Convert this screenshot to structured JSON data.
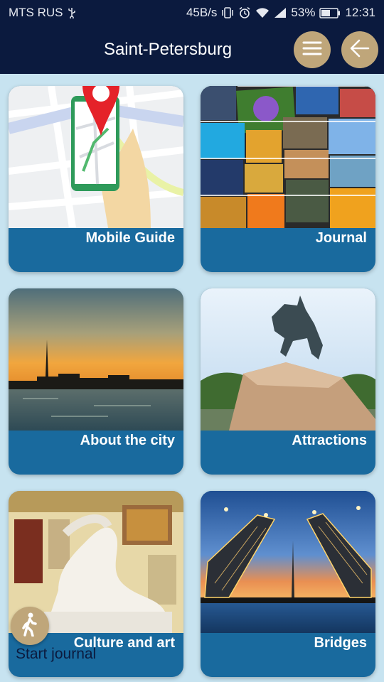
{
  "statusbar": {
    "carrier": "MTS RUS",
    "speed": "45B/s",
    "battery": "53%",
    "time": "12:31"
  },
  "appbar": {
    "title": "Saint-Petersburg",
    "menu_icon": "hamburger-icon",
    "back_icon": "arrow-left-icon"
  },
  "cards": [
    {
      "label": "Mobile Guide"
    },
    {
      "label": "Journal"
    },
    {
      "label": "About the city"
    },
    {
      "label": "Attractions"
    },
    {
      "label": "Culture and art"
    },
    {
      "label": "Bridges"
    }
  ],
  "fab": {
    "icon": "walking-person-icon",
    "label": "Start journal"
  },
  "colors": {
    "header": "#0b1a3e",
    "background": "#c7e3f0",
    "card_footer": "#196a9e",
    "accent": "#bfa67a"
  }
}
